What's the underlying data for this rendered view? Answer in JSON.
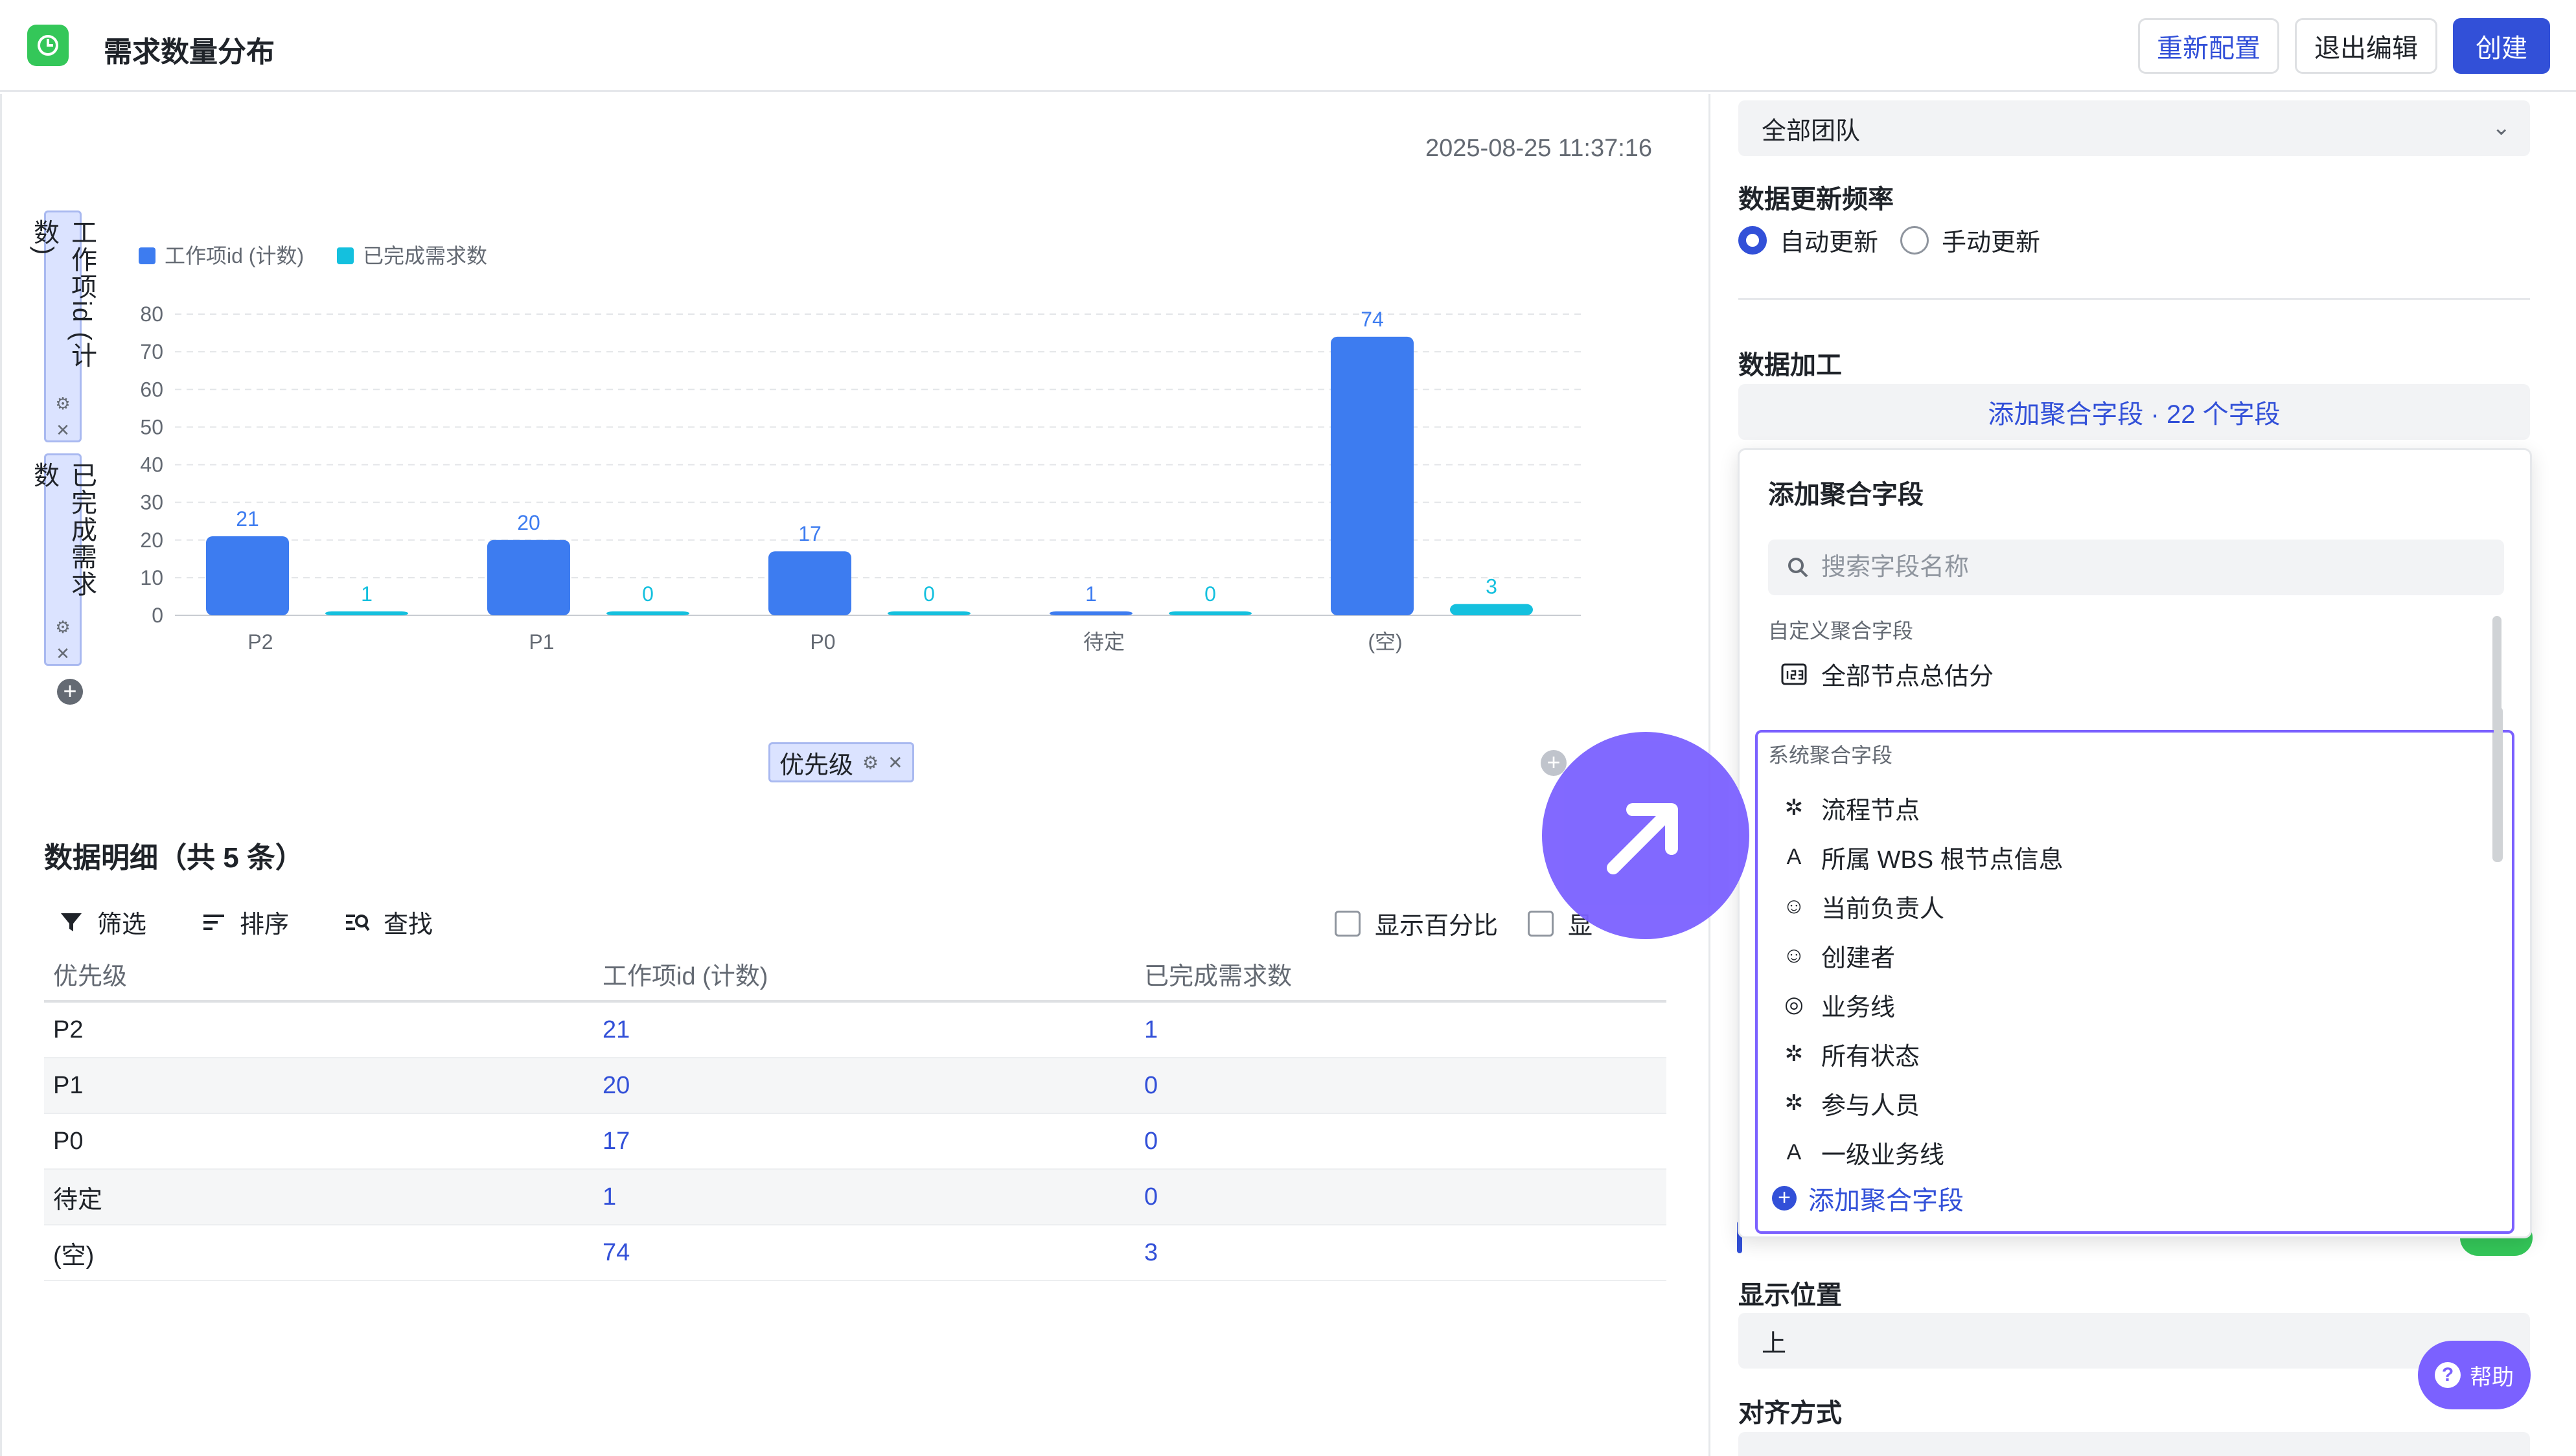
{
  "header": {
    "title": "需求数量分布",
    "buttons": {
      "reconfigure": "重新配置",
      "exit_edit": "退出编辑",
      "create": "创建"
    }
  },
  "chart_area": {
    "timestamp": "2025-08-25 11:37:16",
    "y_fields": [
      "工作项id (计数)",
      "已完成需求数"
    ],
    "x_field": "优先级"
  },
  "chart_data": {
    "type": "bar",
    "categories": [
      "P2",
      "P1",
      "P0",
      "待定",
      "(空)"
    ],
    "series": [
      {
        "name": "工作项id (计数)",
        "values": [
          21,
          20,
          17,
          1,
          74
        ],
        "color": "#3d7cf0"
      },
      {
        "name": "已完成需求数",
        "values": [
          1,
          0,
          0,
          0,
          3
        ],
        "color": "#14c0de"
      }
    ],
    "ylim": [
      0,
      80
    ],
    "yticks": [
      "80",
      "70",
      "60",
      "50",
      "40",
      "30",
      "20",
      "10",
      "0"
    ],
    "grid": true,
    "legend": "top-left"
  },
  "detail": {
    "title": "数据明细（共 5 条）",
    "tools": {
      "filter": "筛选",
      "sort": "排序",
      "find": "查找"
    },
    "checks": {
      "percent": "显示百分比",
      "other": "显"
    },
    "columns": [
      "优先级",
      "工作项id (计数)",
      "已完成需求数"
    ],
    "rows": [
      {
        "priority": "P2",
        "count": "21",
        "done": "1"
      },
      {
        "priority": "P1",
        "count": "20",
        "done": "0"
      },
      {
        "priority": "P0",
        "count": "17",
        "done": "0"
      },
      {
        "priority": "待定",
        "count": "1",
        "done": "0"
      },
      {
        "priority": "(空)",
        "count": "74",
        "done": "3"
      }
    ]
  },
  "right_panel": {
    "team": "全部团队",
    "freq_label": "数据更新频率",
    "freq_auto": "自动更新",
    "freq_manual": "手动更新",
    "process_label": "数据加工",
    "add_agg_bar": "添加聚合字段 · 22 个字段",
    "position_label": "显示位置",
    "position_value": "上",
    "align_label": "对齐方式"
  },
  "popup": {
    "title": "添加聚合字段",
    "search_placeholder": "搜索字段名称",
    "custom_group": "自定义聚合字段",
    "custom_item": "全部节点总估分",
    "system_group": "系统聚合字段",
    "system_items": [
      {
        "label": "流程节点",
        "icon": "star-list-icon"
      },
      {
        "label": "所属 WBS 根节点信息",
        "icon": "text-icon"
      },
      {
        "label": "当前负责人",
        "icon": "user-icon"
      },
      {
        "label": "创建者",
        "icon": "user-icon"
      },
      {
        "label": "业务线",
        "icon": "circle-check-icon"
      },
      {
        "label": "所有状态",
        "icon": "star-list-icon"
      },
      {
        "label": "参与人员",
        "icon": "star-list-icon"
      },
      {
        "label": "一级业务线",
        "icon": "text-icon"
      }
    ],
    "add_link": "添加聚合字段"
  },
  "help": {
    "label": "帮助"
  }
}
